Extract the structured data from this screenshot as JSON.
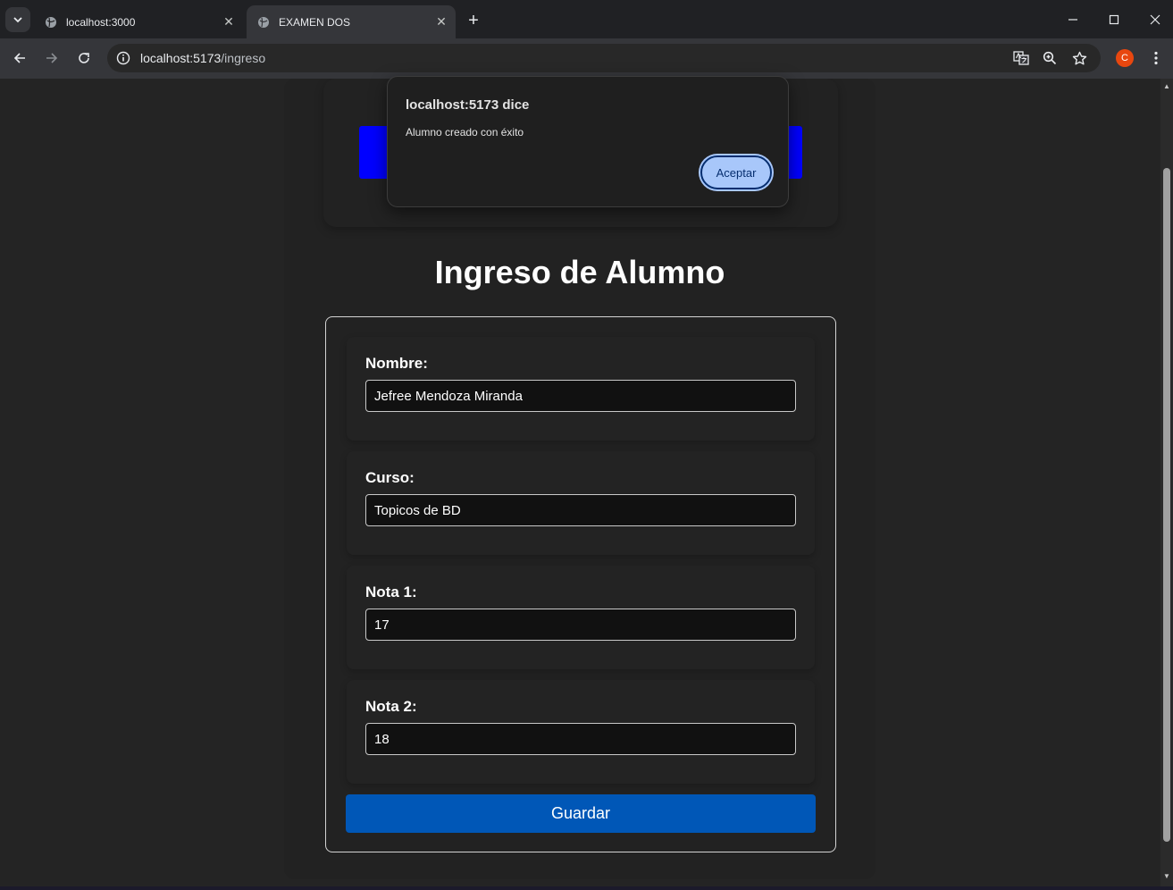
{
  "browser": {
    "tabs": [
      {
        "title": "localhost:3000",
        "active": false
      },
      {
        "title": "EXAMEN DOS",
        "active": true
      }
    ],
    "new_tab_label": "+",
    "close_glyph": "✕",
    "url_host": "localhost:5173",
    "url_path": "/ingreso",
    "profile_initial": "C"
  },
  "page": {
    "heading": "Ingreso de Alumno",
    "banner_color": "#0000ff",
    "fields": [
      {
        "label": "Nombre:",
        "value": "Jefree Mendoza Miranda"
      },
      {
        "label": "Curso:",
        "value": "Topicos de BD"
      },
      {
        "label": "Nota 1:",
        "value": "17"
      },
      {
        "label": "Nota 2:",
        "value": "18"
      }
    ],
    "save_label": "Guardar",
    "save_color": "#0057b7"
  },
  "alert": {
    "origin": "localhost:5173 dice",
    "message": "Alumno creado con éxito",
    "ok_label": "Aceptar"
  }
}
